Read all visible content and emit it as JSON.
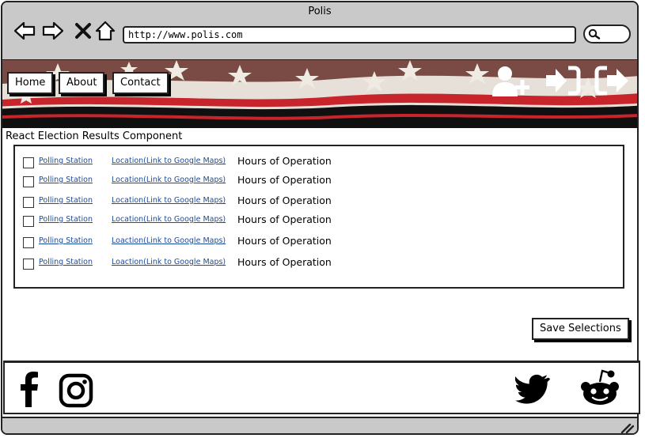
{
  "browser": {
    "title": "Polis",
    "url": "http://www.polis.com"
  },
  "nav": {
    "home": "Home",
    "about": "About",
    "contact": "Contact"
  },
  "component_title": "React Election Results Component",
  "rows": [
    {
      "station": "Polling Station",
      "location": "Location(Link to Google Maps)",
      "hours": "Hours of Operation"
    },
    {
      "station": "Polling Station",
      "location": "Location(Link to Google Maps)",
      "hours": "Hours of Operation"
    },
    {
      "station": "Polling Station",
      "location": "Location(Link to Google Maps)",
      "hours": "Hours of Operation"
    },
    {
      "station": "Polling Station",
      "location": "Location(Link to Google Maps)",
      "hours": "Hours of Operation"
    },
    {
      "station": "Polling Station",
      "location": "Loaction(Link to Google Maps)",
      "hours": "Hours of Operation"
    },
    {
      "station": "Polling Station",
      "location": "Loaction(Link to Google Maps)",
      "hours": "Hours of Operation"
    }
  ],
  "save_label": "Save Selections",
  "icons": {
    "back": "arrow-left-icon",
    "forward": "arrow-right-icon",
    "stop": "close-icon",
    "home": "home-icon",
    "search": "search-icon",
    "add_user": "add-user-icon",
    "sign_in": "sign-in-icon",
    "sign_out": "sign-out-icon",
    "facebook": "facebook-icon",
    "instagram": "instagram-icon",
    "twitter": "twitter-icon",
    "reddit": "reddit-icon"
  },
  "colors": {
    "chrome": "#c9c9c9",
    "link": "#1a4a9a",
    "flag_red": "#c8242c",
    "flag_blue": "#1f2a4e"
  }
}
